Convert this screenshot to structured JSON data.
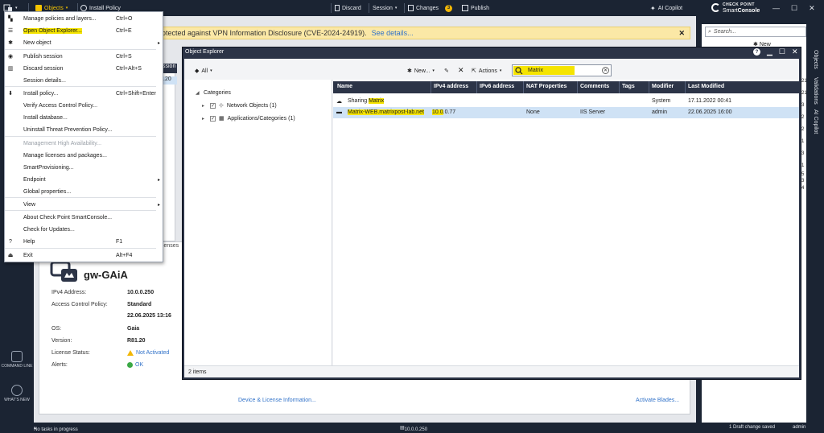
{
  "topbar": {
    "objects_label": "Objects",
    "install_policy_label": "Install Policy",
    "discard_label": "Discard",
    "session_label": "Session",
    "changes_label": "Changes",
    "changes_count": "3",
    "publish_label": "Publish",
    "ai_copilot_label": "AI Copilot",
    "brand_line1": "CHECK POINT",
    "brand_line2_a": "Smart",
    "brand_line2_b": "Console"
  },
  "banner": {
    "text": "otected against VPN Information Disclosure (CVE-2024-24919).",
    "link": "See details..."
  },
  "app_menu": {
    "items": [
      {
        "label": "Manage policies and layers...",
        "shortcut": "Ctrl+O",
        "icon": "layers-icon"
      },
      {
        "label": "Open Object Explorer...",
        "shortcut": "Ctrl+E",
        "icon": "list-icon",
        "highlighted": true
      },
      {
        "label": "New object",
        "shortcut": "",
        "icon": "star-icon",
        "submenu": true
      },
      {
        "label": "Publish session",
        "shortcut": "Ctrl+S",
        "icon": "rss-icon"
      },
      {
        "label": "Discard session",
        "shortcut": "Ctrl+Alt+S",
        "icon": "trash-icon"
      },
      {
        "label": "Session details...",
        "shortcut": "",
        "icon": ""
      },
      {
        "label": "Install policy...",
        "shortcut": "Ctrl+Shift+Enter",
        "icon": "install-icon"
      },
      {
        "label": "Verify Access Control Policy...",
        "shortcut": "",
        "icon": ""
      },
      {
        "label": "Install database...",
        "shortcut": "",
        "icon": ""
      },
      {
        "label": "Uninstall Threat Prevention Policy...",
        "shortcut": "",
        "icon": ""
      },
      {
        "label": "Management High Availability...",
        "shortcut": "",
        "icon": "",
        "disabled": true
      },
      {
        "label": "Manage licenses and packages...",
        "shortcut": "",
        "icon": ""
      },
      {
        "label": "SmartProvisioning...",
        "shortcut": "",
        "icon": ""
      },
      {
        "label": "Endpoint",
        "shortcut": "",
        "icon": "",
        "submenu": true
      },
      {
        "label": "Global properties...",
        "shortcut": "",
        "icon": ""
      },
      {
        "label": "View",
        "shortcut": "",
        "icon": "",
        "submenu": true
      },
      {
        "label": "About Check Point SmartConsole...",
        "shortcut": "",
        "icon": ""
      },
      {
        "label": "Check for Updates...",
        "shortcut": "",
        "icon": ""
      },
      {
        "label": "Help",
        "shortcut": "F1",
        "icon": "help-icon"
      },
      {
        "label": "Exit",
        "shortcut": "Alt+F4",
        "icon": "exit-icon"
      }
    ]
  },
  "left_rail": {
    "command_line": "COMMAND LINE",
    "whats_new": "WHAT'S NEW"
  },
  "background": {
    "header_fragment": "ssion",
    "cell_fragment": ".20",
    "tab_fragment": "censes"
  },
  "gateway": {
    "name": "gw-GAiA",
    "ipv4_label": "IPv4 Address:",
    "ipv4_value": "10.0.0.250",
    "acp_label": "Access Control Policy:",
    "acp_value": "Standard",
    "acp_date": "22.06.2025 13:16",
    "os_label": "OS:",
    "os_value": "Gaia",
    "version_label": "Version:",
    "version_value": "R81.20",
    "license_label": "License Status:",
    "license_value": "Not Activated",
    "alerts_label": "Alerts:",
    "alerts_value": "OK",
    "device_link": "Device & License Information...",
    "activate_link": "Activate Blades..."
  },
  "statusbar": {
    "tasks": "No tasks in progress",
    "server": "10.0.0.250",
    "draft": "1 Draft change saved",
    "user": "admin"
  },
  "right_panel": {
    "search_placeholder": "Search...",
    "new_label": "New",
    "tab_objects": "Objects",
    "tab_validations": "Validations",
    "tab_ai": "AI Copilot",
    "edge_numbers": [
      "21",
      "21",
      "3",
      "2",
      "2",
      "1",
      "3",
      "1",
      "5",
      "3",
      "4"
    ]
  },
  "object_explorer": {
    "title": "Object Explorer",
    "filter_all": "All",
    "new_label": "New...",
    "actions_label": "Actions",
    "search_value": "Matrix",
    "tree": {
      "root": "Categories",
      "children": [
        {
          "label": "Network Objects (1)"
        },
        {
          "label": "Applications/Categories (1)"
        }
      ]
    },
    "columns": [
      "Name",
      "IPv4 address",
      "IPv6 address",
      "NAT Properties",
      "Comments",
      "Tags",
      "Modifier",
      "Last Modified"
    ],
    "rows": [
      {
        "name_pre": "Sharing ",
        "name_hl": "Matrix",
        "name_post": "",
        "ipv4": "",
        "ipv6": "",
        "nat": "",
        "comments": "",
        "tags": "",
        "modifier": "System",
        "modified": "17.11.2022 00:41"
      },
      {
        "name_pre": "",
        "name_hl": "Matrix-WEB.matrixpost-lab.net",
        "name_post": "",
        "ipv4_hl": "10.0",
        "ipv4": ".0.77",
        "ipv6": "",
        "nat": "None",
        "comments": "IIS Server",
        "tags": "",
        "modifier": "admin",
        "modified": "22.06.2025 16:00"
      }
    ],
    "count": "2 items"
  },
  "colors": {
    "chrome": "#1b2433",
    "header": "#2c3447",
    "highlight": "#f5e400",
    "selection": "#cfe2f5",
    "link": "#3172c9"
  }
}
